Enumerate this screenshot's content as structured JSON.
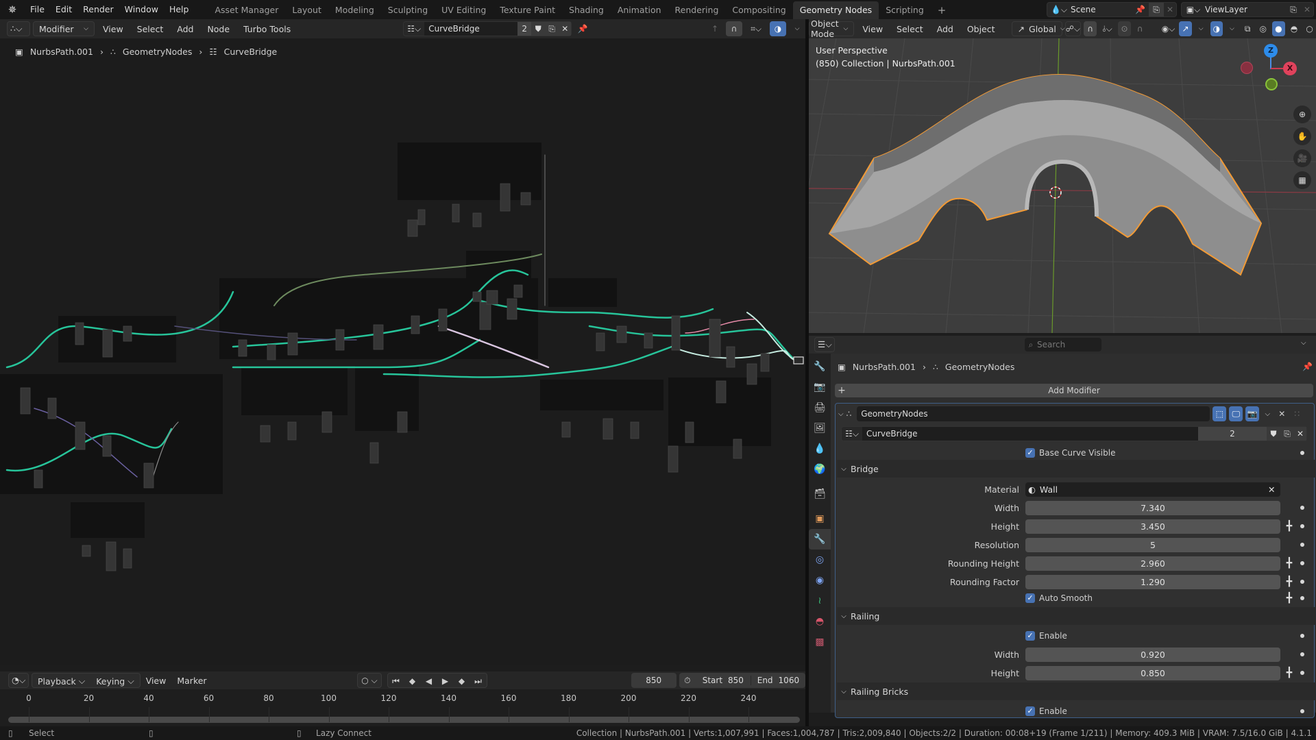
{
  "topbar": {
    "menus": [
      "File",
      "Edit",
      "Render",
      "Window",
      "Help"
    ],
    "workspaces": [
      "Asset Manager",
      "Layout",
      "Modeling",
      "Sculpting",
      "UV Editing",
      "Texture Paint",
      "Shading",
      "Animation",
      "Rendering",
      "Compositing",
      "Geometry Nodes",
      "Scripting"
    ],
    "active_workspace": "Geometry Nodes",
    "add_workspace": "+",
    "scene": "Scene",
    "view_layer": "ViewLayer"
  },
  "node_editor": {
    "editor_type_icon": "geometry-nodes-icon",
    "context": "Modifier",
    "menus": [
      "View",
      "Select",
      "Add",
      "Node",
      "Turbo Tools"
    ],
    "node_group": "CurveBridge",
    "users": "2",
    "breadcrumb": [
      "NurbsPath.001",
      "GeometryNodes",
      "CurveBridge"
    ]
  },
  "viewport": {
    "mode": "Object Mode",
    "menus": [
      "View",
      "Select",
      "Add",
      "Object"
    ],
    "orientation": "Global",
    "overlay_title": "User Perspective",
    "overlay_info": "(850) Collection | NurbsPath.001",
    "gizmo_axes": [
      "Z",
      "X",
      "Y"
    ]
  },
  "properties": {
    "search_placeholder": "Search",
    "breadcrumb": [
      "NurbsPath.001",
      "GeometryNodes"
    ],
    "add_modifier": "Add Modifier",
    "modifier_name": "GeometryNodes",
    "node_group": "CurveBridge",
    "node_group_users": "2",
    "base_curve_visible": {
      "label": "Base Curve Visible",
      "checked": true
    },
    "panels": {
      "bridge": {
        "title": "Bridge",
        "material_label": "Material",
        "material": "Wall",
        "fields": [
          {
            "label": "Width",
            "value": "7.340",
            "keyframe": false
          },
          {
            "label": "Height",
            "value": "3.450",
            "keyframe": true
          },
          {
            "label": "Resolution",
            "value": "5",
            "keyframe": false
          },
          {
            "label": "Rounding Height",
            "value": "2.960",
            "keyframe": true
          },
          {
            "label": "Rounding Factor",
            "value": "1.290",
            "keyframe": true
          }
        ],
        "auto_smooth": {
          "label": "Auto Smooth",
          "checked": true
        }
      },
      "railing": {
        "title": "Railing",
        "enable": {
          "label": "Enable",
          "checked": true
        },
        "fields": [
          {
            "label": "Width",
            "value": "0.920",
            "keyframe": false
          },
          {
            "label": "Height",
            "value": "0.850",
            "keyframe": true
          }
        ]
      },
      "railing_bricks": {
        "title": "Railing Bricks",
        "enable": {
          "label": "Enable",
          "checked": true
        }
      }
    }
  },
  "timeline": {
    "menus": [
      "Playback",
      "Keying",
      "View",
      "Marker"
    ],
    "current_frame": "850",
    "start_label": "Start",
    "start": "850",
    "end_label": "End",
    "end": "1060",
    "ticks": [
      "0",
      "20",
      "40",
      "60",
      "80",
      "100",
      "120",
      "140",
      "160",
      "180",
      "200",
      "220",
      "240"
    ]
  },
  "statusbar": {
    "select": "Select",
    "lazy_connect": "Lazy Connect",
    "stats": "Collection | NurbsPath.001 | Verts:1,007,991 | Faces:1,004,787 | Tris:2,009,840 | Objects:2/2 | Duration: 00:08+19 (Frame 1/211) | Memory: 409.3 MiB | VRAM: 7.5/16.0 GiB | 4.1.1"
  },
  "colors": {
    "accent_blue": "#4772b3",
    "selection_orange": "#f29a35",
    "geometry_socket_green": "#27c49a",
    "node_frame": "#121212"
  }
}
